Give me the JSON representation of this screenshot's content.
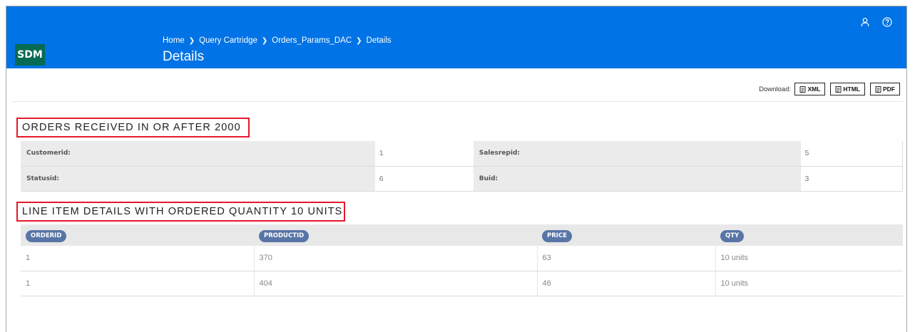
{
  "header": {
    "logo": "SDM",
    "breadcrumb": [
      "Home",
      "Query Cartridge",
      "Orders_Params_DAC",
      "Details"
    ],
    "title": "Details",
    "icons": [
      "user-icon",
      "help-icon"
    ]
  },
  "toolbar": {
    "download_label": "Download:",
    "buttons": [
      {
        "label": "XML",
        "icon": "xml-file-icon"
      },
      {
        "label": "HTML",
        "icon": "html-file-icon"
      },
      {
        "label": "PDF",
        "icon": "pdf-file-icon"
      }
    ]
  },
  "section1": {
    "title": "ORDERS RECEIVED IN OR AFTER 2000",
    "rows": [
      {
        "k1": "Customerid:",
        "v1": "1",
        "k2": "Salesrepid:",
        "v2": "5"
      },
      {
        "k1": "Statusid:",
        "v1": "6",
        "k2": "Buid:",
        "v2": "3"
      }
    ]
  },
  "section2": {
    "title": "LINE ITEM DETAILS WITH ORDERED QUANTITY 10 UNITS",
    "columns": [
      "ORDERID",
      "PRODUCTID",
      "PRICE",
      "QTY"
    ],
    "rows": [
      [
        "1",
        "370",
        "63",
        "10 units"
      ],
      [
        "1",
        "404",
        "46",
        "10 units"
      ]
    ]
  }
}
